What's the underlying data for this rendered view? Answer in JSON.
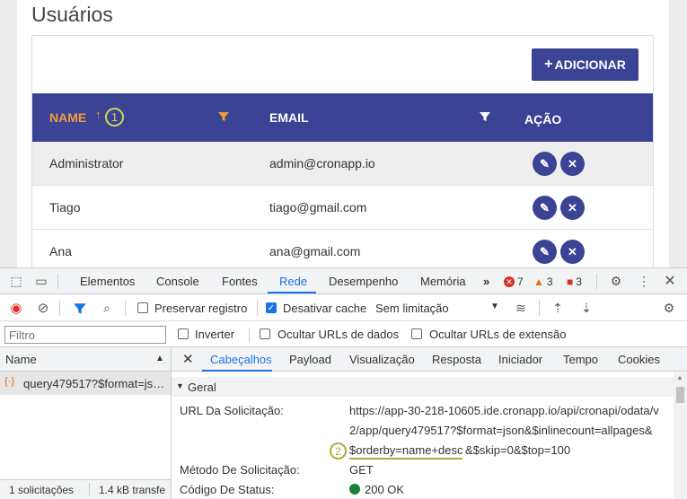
{
  "page": {
    "title": "Usuários",
    "add_button": "ADICIONAR",
    "columns": {
      "name": "NAME",
      "email": "EMAIL",
      "action": "AÇÃO"
    },
    "annotation_1": "1",
    "annotation_2": "2",
    "rows": [
      {
        "name": "Administrator",
        "email": "admin@cronapp.io"
      },
      {
        "name": "Tiago",
        "email": "tiago@gmail.com"
      },
      {
        "name": "Ana",
        "email": "ana@gmail.com"
      }
    ],
    "colors": {
      "primary": "#3b4395",
      "sort_active": "#f19c3e"
    }
  },
  "devtools": {
    "tabs": [
      "Elementos",
      "Console",
      "Fontes",
      "Rede",
      "Desempenho",
      "Memória"
    ],
    "active_tab": "Rede",
    "more": "»",
    "counts": {
      "errors": "7",
      "warnings": "3",
      "issues": "3"
    },
    "toolbar": {
      "preserve_log": "Preservar registro",
      "disable_cache": "Desativar cache",
      "throttling": "Sem limitação"
    },
    "filter_bar": {
      "placeholder": "Filtro",
      "invert": "Inverter",
      "hide_data_urls": "Ocultar URLs de dados",
      "hide_ext_urls": "Ocultar URLs de extensão"
    },
    "request_list": {
      "header": "Name",
      "item": "query479517?$format=js…",
      "footer_requests": "1 solicitações",
      "footer_size": "1.4 kB transfe"
    },
    "detail_tabs": [
      "Cabeçalhos",
      "Payload",
      "Visualização",
      "Resposta",
      "Iniciador",
      "Tempo",
      "Cookies"
    ],
    "active_detail_tab": "Cabeçalhos",
    "section_title": "Geral",
    "headers": {
      "url_label": "URL Da Solicitação:",
      "url_line1": "https://app-30-218-10605.ide.cronapp.io/api/cronapi/odata/v",
      "url_line2": "2/app/query479517?$format=json&$inlinecount=allpages&",
      "url_line3_a": "$orderby=name+desc",
      "url_line3_b": "&$skip=0&$top=100",
      "method_label": "Método De Solicitação:",
      "method_value": "GET",
      "status_label": "Código De Status:",
      "status_value": "200 OK"
    }
  }
}
